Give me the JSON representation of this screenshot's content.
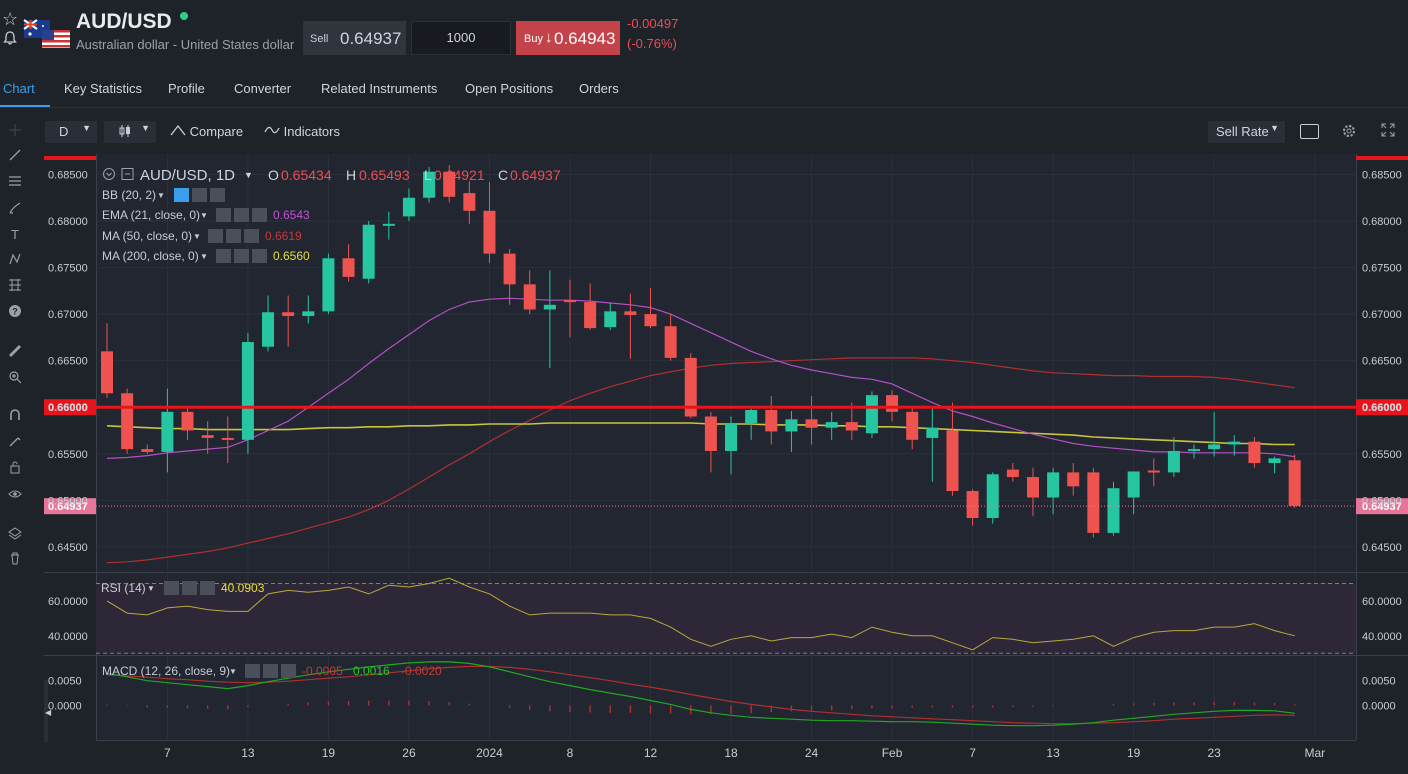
{
  "header": {
    "symbol": "AUD/USD",
    "description": "Australian dollar - United States dollar",
    "sell_label": "Sell",
    "sell_price": "0.64937",
    "quantity": "1000",
    "buy_label": "Buy",
    "buy_arrow": "↓",
    "buy_price": "0.64943",
    "change": "-0.00497",
    "change_pct": "(-0.76%)"
  },
  "tabs": [
    {
      "label": "Chart",
      "active": true
    },
    {
      "label": "Key Statistics"
    },
    {
      "label": "Profile"
    },
    {
      "label": "Converter"
    },
    {
      "label": "Related Instruments"
    },
    {
      "label": "Open Positions"
    },
    {
      "label": "Orders"
    }
  ],
  "toolbar": {
    "interval": "D",
    "compare": "Compare",
    "indicators": "Indicators",
    "rate_type": "Sell Rate"
  },
  "legend": {
    "title": "AUD/USD, 1D",
    "o_label": "O",
    "o_value": "0.65434",
    "h_label": "H",
    "h_value": "0.65493",
    "l_label": "L",
    "l_value": "0.64921",
    "c_label": "C",
    "c_value": "0.64937",
    "bb": "BB (20, 2)",
    "ema": "EMA (21, close, 0)",
    "ema_value": "0.6543",
    "ma50": "MA (50, close, 0)",
    "ma50_value": "0.6619",
    "ma200": "MA (200, close, 0)",
    "ma200_value": "0.6560",
    "rsi": "RSI (14)",
    "rsi_value": "40.0903",
    "macd": "MACD (12, 26, close, 9)",
    "macd_hist": "-0.0005",
    "macd_line": "0.0016",
    "macd_signal": "-0.0020"
  },
  "colors": {
    "up": "#26c6a2",
    "down": "#ef5350",
    "ema": "#b34fc7",
    "ma50": "#b0302f",
    "ma200": "#c9c43a",
    "hline": "#e8141c",
    "price_tag": "#e7759a"
  },
  "chart_data": {
    "type": "candlestick",
    "y_ticks": [
      "0.68500",
      "0.68000",
      "0.67500",
      "0.67000",
      "0.66500",
      "0.66000",
      "0.65500",
      "0.65000",
      "0.64500"
    ],
    "ylim": [
      0.6423,
      0.6872
    ],
    "horizontal_line": {
      "value": 0.66,
      "label": "0.66000"
    },
    "last_price": {
      "value": 0.64937,
      "label": "0.64937"
    },
    "x_ticks": [
      {
        "label": "7",
        "index": 3
      },
      {
        "label": "13",
        "index": 7
      },
      {
        "label": "19",
        "index": 11
      },
      {
        "label": "26",
        "index": 15
      },
      {
        "label": "2024",
        "index": 19
      },
      {
        "label": "8",
        "index": 23
      },
      {
        "label": "12",
        "index": 27
      },
      {
        "label": "18",
        "index": 31
      },
      {
        "label": "24",
        "index": 35
      },
      {
        "label": "Feb",
        "index": 39
      },
      {
        "label": "7",
        "index": 43
      },
      {
        "label": "13",
        "index": 47
      },
      {
        "label": "19",
        "index": 51
      },
      {
        "label": "23",
        "index": 55
      },
      {
        "label": "Mar",
        "index": 60
      }
    ],
    "candles": [
      {
        "o": 0.666,
        "h": 0.669,
        "l": 0.661,
        "c": 0.6615
      },
      {
        "o": 0.6615,
        "h": 0.662,
        "l": 0.655,
        "c": 0.6555
      },
      {
        "o": 0.6555,
        "h": 0.656,
        "l": 0.655,
        "c": 0.6552
      },
      {
        "o": 0.6552,
        "h": 0.662,
        "l": 0.653,
        "c": 0.6595
      },
      {
        "o": 0.6595,
        "h": 0.66,
        "l": 0.6565,
        "c": 0.6575
      },
      {
        "o": 0.657,
        "h": 0.6585,
        "l": 0.655,
        "c": 0.6567
      },
      {
        "o": 0.6567,
        "h": 0.659,
        "l": 0.654,
        "c": 0.6565
      },
      {
        "o": 0.6565,
        "h": 0.668,
        "l": 0.655,
        "c": 0.667
      },
      {
        "o": 0.6665,
        "h": 0.672,
        "l": 0.666,
        "c": 0.6702
      },
      {
        "o": 0.6702,
        "h": 0.672,
        "l": 0.6665,
        "c": 0.6698
      },
      {
        "o": 0.6698,
        "h": 0.672,
        "l": 0.669,
        "c": 0.6703
      },
      {
        "o": 0.6703,
        "h": 0.6765,
        "l": 0.67,
        "c": 0.676
      },
      {
        "o": 0.676,
        "h": 0.6775,
        "l": 0.6735,
        "c": 0.674
      },
      {
        "o": 0.6738,
        "h": 0.68,
        "l": 0.6733,
        "c": 0.6796
      },
      {
        "o": 0.6796,
        "h": 0.681,
        "l": 0.678,
        "c": 0.6797
      },
      {
        "o": 0.6805,
        "h": 0.6835,
        "l": 0.68,
        "c": 0.6825
      },
      {
        "o": 0.6825,
        "h": 0.6858,
        "l": 0.682,
        "c": 0.6853
      },
      {
        "o": 0.6853,
        "h": 0.686,
        "l": 0.682,
        "c": 0.6826
      },
      {
        "o": 0.683,
        "h": 0.6843,
        "l": 0.6797,
        "c": 0.6811
      },
      {
        "o": 0.6811,
        "h": 0.6842,
        "l": 0.6755,
        "c": 0.6765
      },
      {
        "o": 0.6765,
        "h": 0.677,
        "l": 0.671,
        "c": 0.6732
      },
      {
        "o": 0.6732,
        "h": 0.6747,
        "l": 0.67,
        "c": 0.6705
      },
      {
        "o": 0.6705,
        "h": 0.6747,
        "l": 0.6642,
        "c": 0.671
      },
      {
        "o": 0.6715,
        "h": 0.6737,
        "l": 0.6675,
        "c": 0.6714
      },
      {
        "o": 0.6713,
        "h": 0.6733,
        "l": 0.6683,
        "c": 0.6685
      },
      {
        "o": 0.6686,
        "h": 0.6712,
        "l": 0.6683,
        "c": 0.6703
      },
      {
        "o": 0.6703,
        "h": 0.6722,
        "l": 0.6652,
        "c": 0.6699
      },
      {
        "o": 0.67,
        "h": 0.6728,
        "l": 0.6685,
        "c": 0.6687
      },
      {
        "o": 0.6687,
        "h": 0.67,
        "l": 0.665,
        "c": 0.6653
      },
      {
        "o": 0.6653,
        "h": 0.6658,
        "l": 0.6588,
        "c": 0.659
      },
      {
        "o": 0.659,
        "h": 0.6595,
        "l": 0.653,
        "c": 0.6553
      },
      {
        "o": 0.6553,
        "h": 0.659,
        "l": 0.6528,
        "c": 0.6583
      },
      {
        "o": 0.6583,
        "h": 0.66,
        "l": 0.6565,
        "c": 0.6597
      },
      {
        "o": 0.6597,
        "h": 0.6612,
        "l": 0.656,
        "c": 0.6574
      },
      {
        "o": 0.6574,
        "h": 0.6596,
        "l": 0.6552,
        "c": 0.6587
      },
      {
        "o": 0.6587,
        "h": 0.6612,
        "l": 0.656,
        "c": 0.6578
      },
      {
        "o": 0.6578,
        "h": 0.6595,
        "l": 0.6565,
        "c": 0.6584
      },
      {
        "o": 0.6584,
        "h": 0.6605,
        "l": 0.6565,
        "c": 0.6575
      },
      {
        "o": 0.6572,
        "h": 0.6617,
        "l": 0.6567,
        "c": 0.6613
      },
      {
        "o": 0.6613,
        "h": 0.6618,
        "l": 0.6585,
        "c": 0.6595
      },
      {
        "o": 0.6595,
        "h": 0.66,
        "l": 0.6555,
        "c": 0.6565
      },
      {
        "o": 0.6567,
        "h": 0.66,
        "l": 0.652,
        "c": 0.6578
      },
      {
        "o": 0.6575,
        "h": 0.6605,
        "l": 0.6505,
        "c": 0.651
      },
      {
        "o": 0.651,
        "h": 0.6512,
        "l": 0.6473,
        "c": 0.6481
      },
      {
        "o": 0.6481,
        "h": 0.653,
        "l": 0.6475,
        "c": 0.6528
      },
      {
        "o": 0.6533,
        "h": 0.654,
        "l": 0.652,
        "c": 0.6525
      },
      {
        "o": 0.6525,
        "h": 0.6535,
        "l": 0.6483,
        "c": 0.6503
      },
      {
        "o": 0.6503,
        "h": 0.6535,
        "l": 0.6485,
        "c": 0.653
      },
      {
        "o": 0.653,
        "h": 0.654,
        "l": 0.6505,
        "c": 0.6515
      },
      {
        "o": 0.653,
        "h": 0.6535,
        "l": 0.646,
        "c": 0.6465
      },
      {
        "o": 0.6465,
        "h": 0.652,
        "l": 0.6462,
        "c": 0.6513
      },
      {
        "o": 0.6503,
        "h": 0.6528,
        "l": 0.6485,
        "c": 0.6531
      },
      {
        "o": 0.6532,
        "h": 0.6545,
        "l": 0.6515,
        "c": 0.653
      },
      {
        "o": 0.653,
        "h": 0.6568,
        "l": 0.6525,
        "c": 0.6553
      },
      {
        "o": 0.6553,
        "h": 0.656,
        "l": 0.6545,
        "c": 0.6555
      },
      {
        "o": 0.6555,
        "h": 0.6595,
        "l": 0.6547,
        "c": 0.656
      },
      {
        "o": 0.656,
        "h": 0.657,
        "l": 0.6548,
        "c": 0.6563
      },
      {
        "o": 0.6563,
        "h": 0.6568,
        "l": 0.6535,
        "c": 0.654
      },
      {
        "o": 0.654,
        "h": 0.6547,
        "l": 0.6529,
        "c": 0.6545
      },
      {
        "o": 0.6543,
        "h": 0.6549,
        "l": 0.6492,
        "c": 0.6494
      }
    ],
    "ema": [
      0.6545,
      0.6546,
      0.6548,
      0.6551,
      0.6553,
      0.6555,
      0.6557,
      0.6565,
      0.6575,
      0.6585,
      0.66,
      0.6615,
      0.663,
      0.6647,
      0.6663,
      0.6678,
      0.6693,
      0.6705,
      0.6713,
      0.6716,
      0.6717,
      0.6716,
      0.6715,
      0.6715,
      0.6714,
      0.6712,
      0.671,
      0.6707,
      0.67,
      0.669,
      0.668,
      0.667,
      0.666,
      0.6652,
      0.6645,
      0.664,
      0.6636,
      0.6632,
      0.663,
      0.6625,
      0.6615,
      0.6605,
      0.6596,
      0.659,
      0.6583,
      0.6577,
      0.6571,
      0.6566,
      0.6561,
      0.6558,
      0.6556,
      0.6554,
      0.6552,
      0.6552,
      0.6551,
      0.6551,
      0.6551,
      0.6551,
      0.655,
      0.6547
    ],
    "ma50": [
      0.6433,
      0.6434,
      0.6436,
      0.6439,
      0.6442,
      0.6445,
      0.6449,
      0.6454,
      0.6459,
      0.6464,
      0.647,
      0.6476,
      0.6482,
      0.649,
      0.65,
      0.6512,
      0.6525,
      0.6538,
      0.655,
      0.6563,
      0.6575,
      0.6586,
      0.6597,
      0.6607,
      0.6615,
      0.6622,
      0.6628,
      0.6634,
      0.6638,
      0.6642,
      0.6645,
      0.6647,
      0.6648,
      0.6649,
      0.665,
      0.6651,
      0.6652,
      0.6653,
      0.6653,
      0.6653,
      0.6653,
      0.6652,
      0.665,
      0.6648,
      0.6645,
      0.6642,
      0.6639,
      0.6637,
      0.6636,
      0.6635,
      0.6634,
      0.6634,
      0.6633,
      0.6633,
      0.6633,
      0.6632,
      0.663,
      0.6627,
      0.6624,
      0.6621
    ],
    "ma200": [
      0.658,
      0.6579,
      0.6578,
      0.6577,
      0.6577,
      0.6576,
      0.6576,
      0.6576,
      0.6576,
      0.6576,
      0.6577,
      0.6578,
      0.6578,
      0.6579,
      0.6579,
      0.658,
      0.658,
      0.6581,
      0.6581,
      0.6582,
      0.6582,
      0.6582,
      0.6583,
      0.6583,
      0.6583,
      0.6583,
      0.6583,
      0.6583,
      0.6583,
      0.6583,
      0.6582,
      0.6582,
      0.6582,
      0.6581,
      0.6581,
      0.6581,
      0.658,
      0.658,
      0.6579,
      0.6579,
      0.6578,
      0.6577,
      0.6576,
      0.6575,
      0.6574,
      0.6573,
      0.6572,
      0.6571,
      0.657,
      0.6568,
      0.6567,
      0.6566,
      0.6565,
      0.6564,
      0.6563,
      0.6562,
      0.6561,
      0.6561,
      0.656,
      0.656
    ],
    "rsi_ticks": [
      "60.0000",
      "40.0000"
    ],
    "rsi": [
      60,
      53,
      52,
      56,
      57,
      55,
      54,
      54,
      64,
      66,
      65,
      66,
      68,
      64,
      69,
      68,
      70,
      73,
      68,
      64,
      57,
      52,
      53,
      53,
      53,
      52,
      52,
      50,
      45,
      38,
      34,
      38,
      40,
      37,
      39,
      39,
      41,
      39,
      45,
      42,
      40,
      40,
      36,
      32,
      39,
      38,
      36,
      37,
      38,
      40,
      34,
      39,
      42,
      43,
      43,
      45,
      45,
      47,
      43,
      40
    ],
    "macd_ticks": [
      "0.0050",
      "0.0000"
    ],
    "macd_line": [
      0.0065,
      0.0058,
      0.005,
      0.0046,
      0.0042,
      0.0038,
      0.0034,
      0.004,
      0.0048,
      0.0055,
      0.0062,
      0.0068,
      0.0073,
      0.0078,
      0.0082,
      0.0086,
      0.0088,
      0.0088,
      0.0085,
      0.0078,
      0.0068,
      0.0058,
      0.0048,
      0.004,
      0.0032,
      0.0025,
      0.0018,
      0.001,
      0.0002,
      -0.0008,
      -0.0015,
      -0.002,
      -0.0024,
      -0.0026,
      -0.0028,
      -0.003,
      -0.0031,
      -0.0031,
      -0.0032,
      -0.0033,
      -0.0033,
      -0.0034,
      -0.0036,
      -0.0038,
      -0.004,
      -0.0041,
      -0.0041,
      -0.004,
      -0.0038,
      -0.0035,
      -0.003,
      -0.0026,
      -0.0022,
      -0.0018,
      -0.0015,
      -0.0012,
      -0.001,
      -0.001,
      -0.0011,
      -0.0016
    ],
    "macd_signal": [
      0.0062,
      0.006,
      0.0057,
      0.0054,
      0.0052,
      0.0049,
      0.0047,
      0.0046,
      0.0047,
      0.0049,
      0.0052,
      0.0055,
      0.0058,
      0.0062,
      0.0066,
      0.007,
      0.0074,
      0.0077,
      0.0079,
      0.0079,
      0.0077,
      0.0073,
      0.0068,
      0.0062,
      0.0056,
      0.005,
      0.0043,
      0.0037,
      0.003,
      0.0022,
      0.0015,
      0.0008,
      0.0002,
      -0.0003,
      -0.0008,
      -0.0012,
      -0.0015,
      -0.0018,
      -0.0021,
      -0.0023,
      -0.0025,
      -0.0027,
      -0.0029,
      -0.0031,
      -0.0033,
      -0.0035,
      -0.0036,
      -0.0037,
      -0.0037,
      -0.0036,
      -0.0035,
      -0.0033,
      -0.0031,
      -0.0028,
      -0.0026,
      -0.0024,
      -0.0022,
      -0.002,
      -0.0019,
      -0.002
    ]
  }
}
